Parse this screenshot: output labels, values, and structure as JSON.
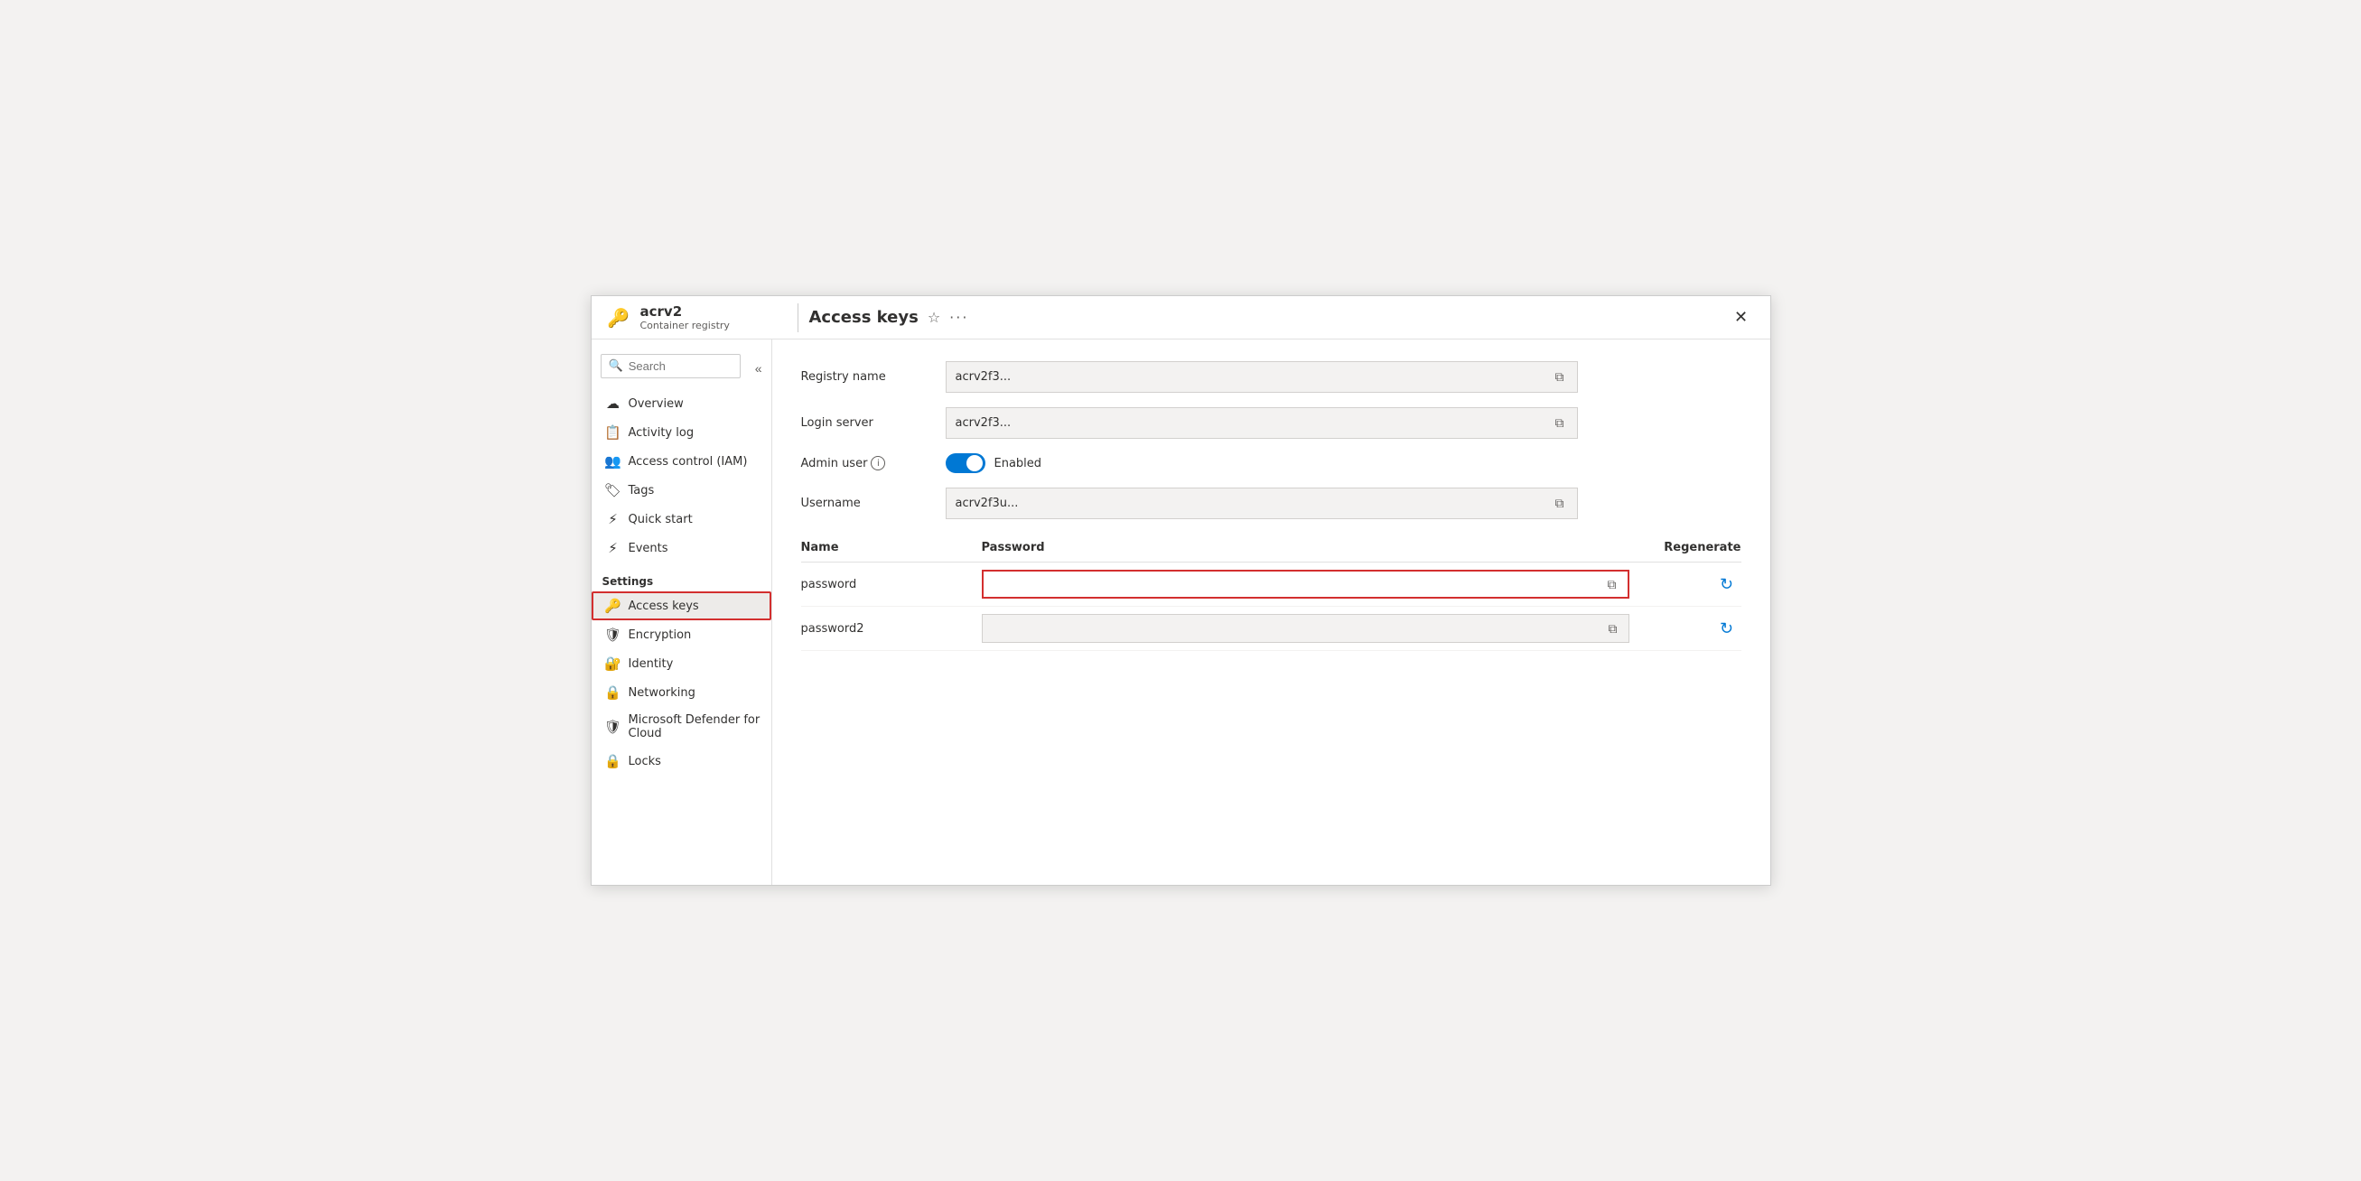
{
  "app": {
    "icon": "🔑",
    "title": "acrv2",
    "subtitle": "Container registry"
  },
  "header": {
    "page_title": "Access keys",
    "star_label": "☆",
    "ellipsis_label": "···",
    "close_label": "✕"
  },
  "sidebar": {
    "search_placeholder": "Search",
    "collapse_label": "«",
    "nav_items": [
      {
        "id": "overview",
        "label": "Overview",
        "icon": "☁"
      },
      {
        "id": "activity-log",
        "label": "Activity log",
        "icon": "📋"
      },
      {
        "id": "access-control",
        "label": "Access control (IAM)",
        "icon": "👥"
      },
      {
        "id": "tags",
        "label": "Tags",
        "icon": "🏷"
      },
      {
        "id": "quick-start",
        "label": "Quick start",
        "icon": "⚡"
      },
      {
        "id": "events",
        "label": "Events",
        "icon": "⚡"
      }
    ],
    "settings_label": "Settings",
    "settings_items": [
      {
        "id": "access-keys",
        "label": "Access keys",
        "icon": "🔑",
        "active": true
      },
      {
        "id": "encryption",
        "label": "Encryption",
        "icon": "🛡"
      },
      {
        "id": "identity",
        "label": "Identity",
        "icon": "🔐"
      },
      {
        "id": "networking",
        "label": "Networking",
        "icon": "🔒"
      },
      {
        "id": "defender",
        "label": "Microsoft Defender for Cloud",
        "icon": "🛡"
      },
      {
        "id": "locks",
        "label": "Locks",
        "icon": "🔒"
      }
    ]
  },
  "main": {
    "fields": {
      "registry_name_label": "Registry name",
      "registry_name_value": "acrv2f3...",
      "login_server_label": "Login server",
      "login_server_value": "acrv2f3...",
      "admin_user_label": "Admin user",
      "admin_user_enabled": "Enabled",
      "username_label": "Username",
      "username_value": "acrv2f3u..."
    },
    "table": {
      "col_name": "Name",
      "col_password": "Password",
      "col_regenerate": "Regenerate",
      "rows": [
        {
          "name": "password",
          "password": "",
          "highlighted": true
        },
        {
          "name": "password2",
          "password": "",
          "highlighted": false
        }
      ]
    }
  }
}
